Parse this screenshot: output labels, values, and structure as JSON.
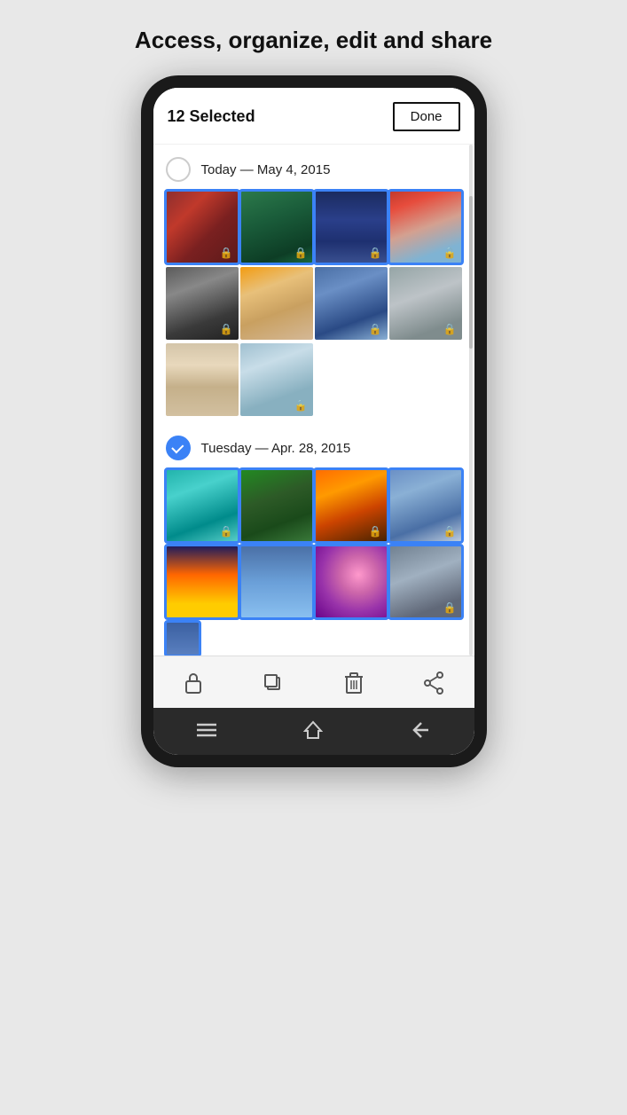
{
  "page": {
    "title": "Access, organize, edit and share",
    "selection": {
      "count_label": "12 Selected",
      "done_label": "Done"
    },
    "sections": [
      {
        "id": "today",
        "date_label": "Today — May 4, 2015",
        "checked": false,
        "photos": [
          {
            "id": "wreath",
            "class": "photo-wreath",
            "selected": true,
            "locked": true
          },
          {
            "id": "waterfall",
            "class": "photo-waterfall",
            "selected": true,
            "locked": true
          },
          {
            "id": "bridge",
            "class": "photo-bridge",
            "selected": true,
            "locked": true
          },
          {
            "id": "kids",
            "class": "photo-kids",
            "selected": true,
            "locked": true
          },
          {
            "id": "rock",
            "class": "photo-rock",
            "selected": false,
            "locked": true
          },
          {
            "id": "family",
            "class": "photo-family",
            "selected": false,
            "locked": false
          },
          {
            "id": "mountain",
            "class": "photo-mountain",
            "selected": false,
            "locked": true
          },
          {
            "id": "rain",
            "class": "photo-rain",
            "selected": false,
            "locked": true
          },
          {
            "id": "woman",
            "class": "photo-woman",
            "selected": false,
            "locked": false
          },
          {
            "id": "car",
            "class": "photo-car",
            "selected": false,
            "locked": true
          }
        ]
      },
      {
        "id": "tuesday",
        "date_label": "Tuesday — Apr. 28, 2015",
        "checked": true,
        "photos": [
          {
            "id": "bird",
            "class": "photo-bird",
            "selected": true,
            "locked": true
          },
          {
            "id": "forest2",
            "class": "photo-forest2",
            "selected": true,
            "locked": false
          },
          {
            "id": "campfire",
            "class": "photo-campfire",
            "selected": true,
            "locked": true
          },
          {
            "id": "matterhorn",
            "class": "photo-matterhorn",
            "selected": true,
            "locked": true
          },
          {
            "id": "sunset",
            "class": "photo-sunset",
            "selected": true,
            "locked": false
          },
          {
            "id": "bluemtn",
            "class": "photo-bluemtn",
            "selected": true,
            "locked": false
          },
          {
            "id": "bokeh",
            "class": "photo-bokeh",
            "selected": true,
            "locked": false
          },
          {
            "id": "rain2",
            "class": "photo-rain2",
            "selected": true,
            "locked": true
          }
        ]
      }
    ],
    "partial_row": [
      {
        "id": "partial1",
        "class": "photo-partial",
        "selected": true
      }
    ],
    "toolbar": {
      "lock_label": "🔒",
      "copy_label": "⧉",
      "delete_label": "🗑",
      "share_label": "⇧"
    },
    "nav": {
      "menu_icon": "☰",
      "home_icon": "⌂",
      "back_icon": "←"
    }
  }
}
